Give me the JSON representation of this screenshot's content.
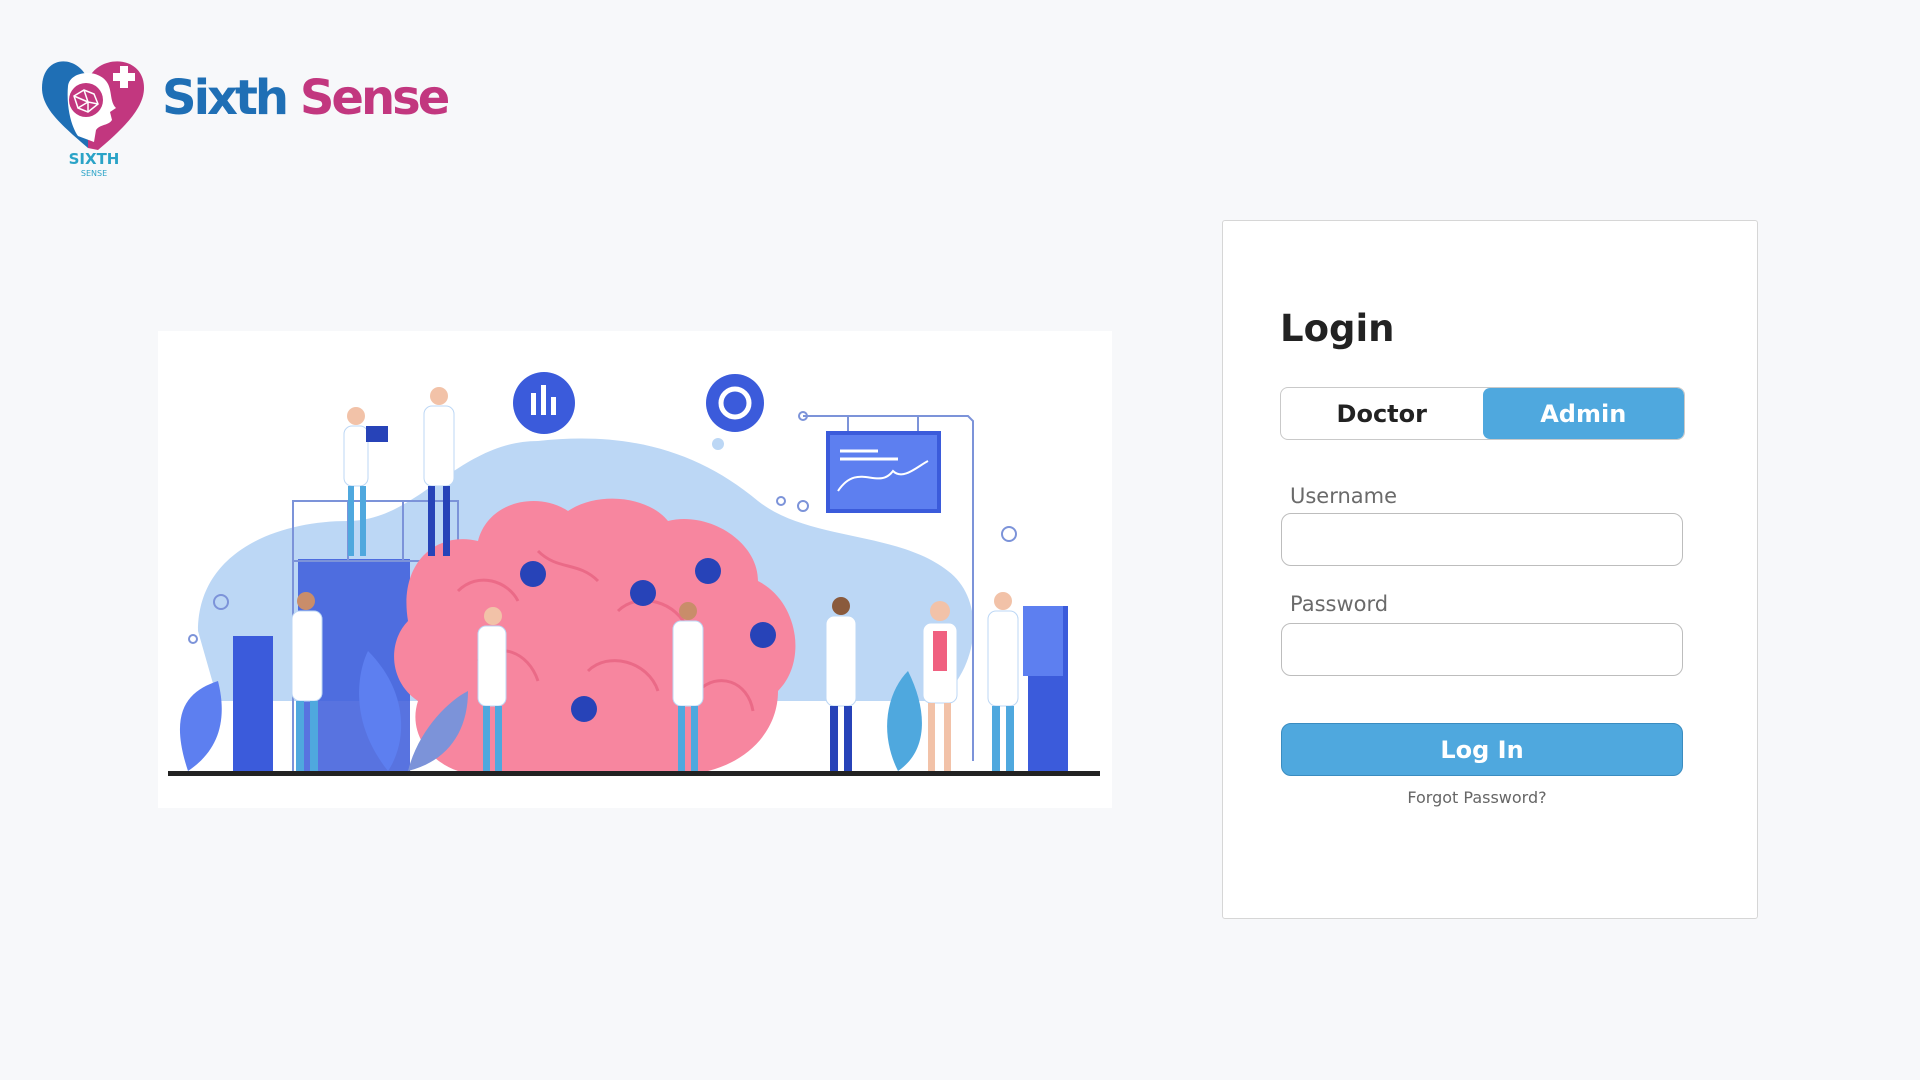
{
  "brand": {
    "name_part1": "Sixth",
    "name_part2": " Sense",
    "logo_caption": "SIXTH",
    "logo_subcaption": "SENSE",
    "primary_color": "#1f6fb5",
    "secondary_color": "#c2377f"
  },
  "illustration": {
    "icon": "medical-team-brain-illustration"
  },
  "login": {
    "title": "Login",
    "roles": [
      "Doctor",
      "Admin"
    ],
    "active_role": "Admin",
    "username_label": "Username",
    "username_value": "",
    "password_label": "Password",
    "password_value": "",
    "submit_label": "Log In",
    "forgot_label": "Forgot Password?",
    "accent_color": "#4fa8de"
  }
}
